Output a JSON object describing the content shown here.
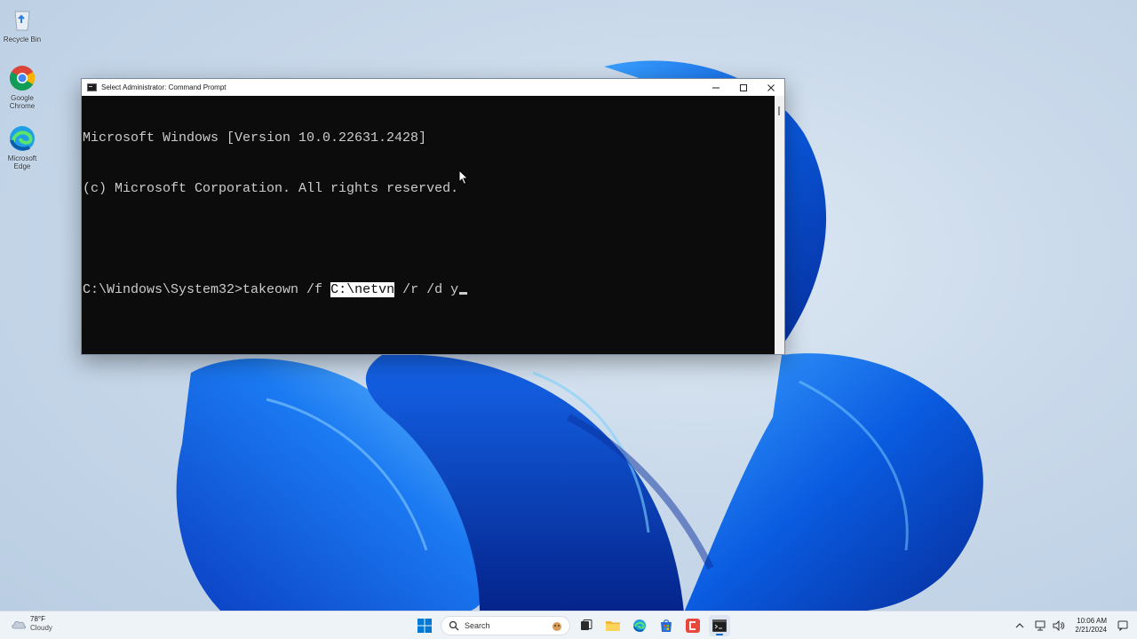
{
  "desktop": {
    "icons": [
      {
        "label": "Recycle Bin"
      },
      {
        "label": "Google Chrome"
      },
      {
        "label": "Microsoft Edge"
      }
    ]
  },
  "window": {
    "title": "Select Administrator: Command Prompt",
    "controls": {
      "minimize": "—",
      "maximize": "☐",
      "close": "✕"
    }
  },
  "console": {
    "line1": "Microsoft Windows [Version 10.0.22631.2428]",
    "line2": "(c) Microsoft Corporation. All rights reserved.",
    "prompt": "C:\\Windows\\System32>",
    "command_before": "takeown /f ",
    "selected": "C:\\netvn",
    "command_after": " /r /d y"
  },
  "taskbar": {
    "weather": {
      "temp": "78°F",
      "condition": "Cloudy"
    },
    "search_placeholder": "Search",
    "apps": [
      "start",
      "search",
      "task-view",
      "file-explorer",
      "edge",
      "microsoft-store",
      "capcut",
      "terminal"
    ],
    "clock": {
      "time": "10:06 AM",
      "date": "2/21/2024"
    },
    "accent": "#0067c0"
  }
}
